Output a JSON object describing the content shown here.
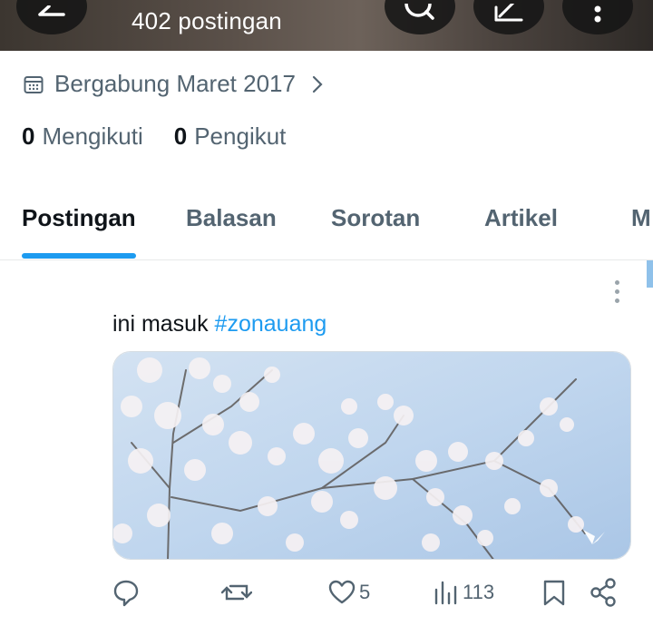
{
  "header": {
    "post_count": "402 postingan",
    "buttons": [
      "back-icon",
      "search-icon",
      "edit-icon",
      "more-icon"
    ]
  },
  "profile": {
    "joined": "Bergabung Maret 2017",
    "following_count": "0",
    "following_label": "Mengikuti",
    "followers_count": "0",
    "followers_label": "Pengikut"
  },
  "tabs": [
    {
      "label": "Postingan",
      "active": true
    },
    {
      "label": "Balasan",
      "active": false
    },
    {
      "label": "Sorotan",
      "active": false
    },
    {
      "label": "Artikel",
      "active": false
    },
    {
      "label": "M",
      "active": false
    }
  ],
  "tweet": {
    "text": "ini masuk ",
    "hashtag": "#zonauang",
    "media_alt": "cherry blossom branches against blue sky",
    "likes": "5",
    "views": "113"
  },
  "colors": {
    "accent": "#1d9bf0",
    "muted": "#536471",
    "text": "#0f1419"
  }
}
